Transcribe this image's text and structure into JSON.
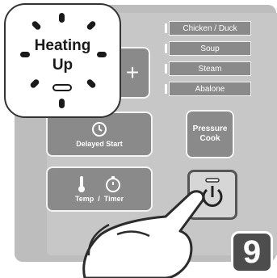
{
  "bubble": {
    "line1": "Heating",
    "line2": "Up"
  },
  "menu": {
    "items": [
      "Chicken / Duck",
      "Soup",
      "Steam",
      "Abalone"
    ]
  },
  "buttons": {
    "plus": "+",
    "delayed_start": "Delayed Start",
    "temp_timer": "Temp  /  Timer",
    "pressure_cook": "Pressure\nCook"
  },
  "step_number": "9",
  "colors": {
    "panel": "#bdbdbd",
    "button": "#8a8a8a",
    "badge": "#4d4d4d"
  },
  "icons": [
    "clock-icon",
    "thermometer-icon",
    "stopwatch-icon",
    "power-icon",
    "hand-pointer-icon"
  ]
}
